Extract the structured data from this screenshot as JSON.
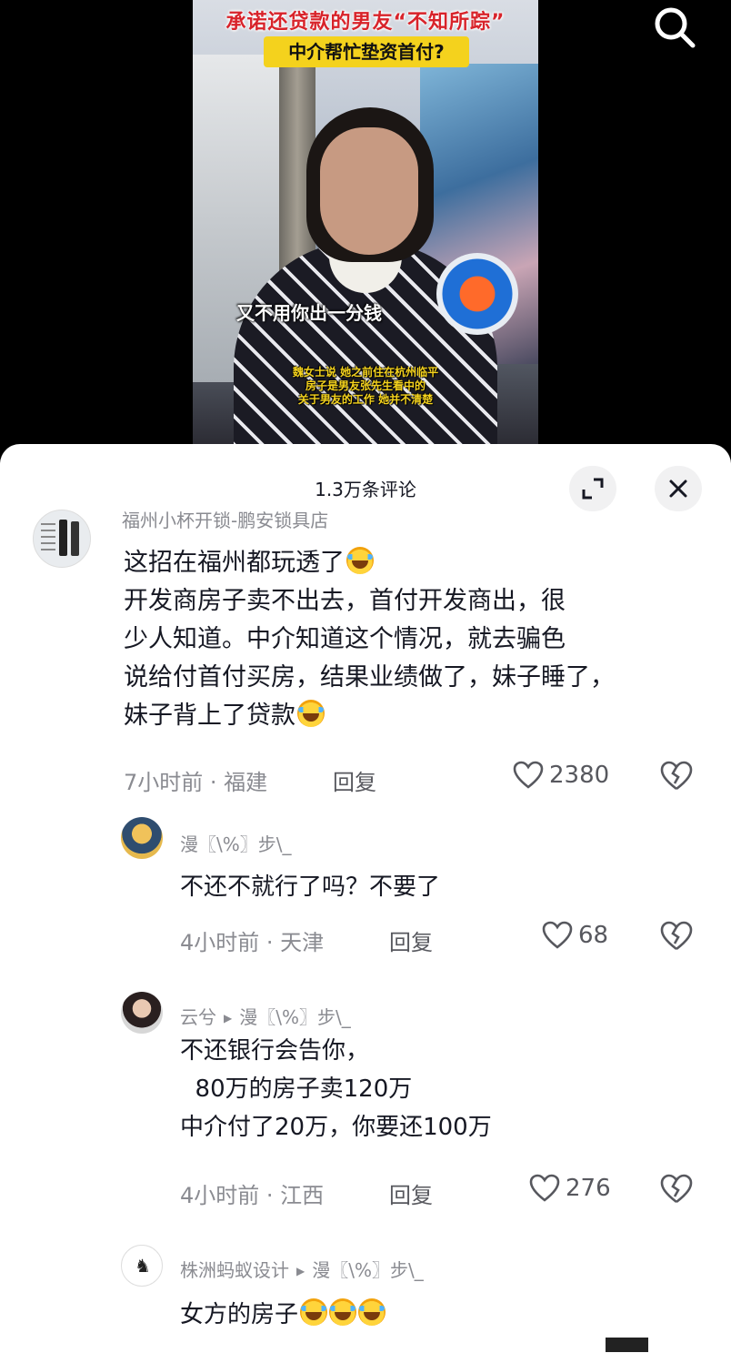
{
  "video": {
    "title": "承诺还贷款的男友“不知所踪”",
    "subtitle": "中介帮忙垫资首付?",
    "quote": "又不用你出一分钱",
    "caption_lines": [
      "魏女士说 她之前住在杭州临平",
      "房子是男友张先生看中的",
      "关于男友的工作 她并不清楚"
    ]
  },
  "sheet": {
    "title": "1.3万条评论"
  },
  "comments": {
    "main": {
      "username": "福州小杯开锁-鹏安锁具店",
      "text": "这招在福州都玩透了",
      "text_lines": [
        "开发商房子卖不出去，首付开发商出，很",
        "少人知道。中介知道这个情况，就去骗色",
        "说给付首付买房，结果业绩做了，妹子睡了，",
        "妹子背上了贷款"
      ],
      "time": "7小时前 · 福建",
      "reply_label": "回复",
      "likes": "2380"
    },
    "reply1": {
      "username": "漫〖\\%〗步\\_",
      "text": "不还不就行了吗？不要了",
      "time": "4小时前 · 天津",
      "reply_label": "回复",
      "likes": "68"
    },
    "reply2": {
      "username": "云兮",
      "reply_to": "漫〖\\%〗步\\_",
      "text_lines": [
        "不还银行会告你，",
        "  80万的房子卖120万",
        "中介付了20万，你要还100万"
      ],
      "time": "4小时前 · 江西",
      "reply_label": "回复",
      "likes": "276"
    },
    "reply3": {
      "username": "株洲蚂蚁设计",
      "reply_to": "漫〖\\%〗步\\_",
      "text": "女方的房子"
    }
  },
  "colors": {
    "title_red": "#d8232a",
    "subtitle_yellow": "#f4d21d",
    "text_primary": "#161823",
    "text_secondary": "#8a8b91"
  },
  "icons": {
    "search": "search-icon",
    "expand": "expand-icon",
    "close": "close-icon",
    "like": "heart-icon",
    "dislike": "broken-heart-icon",
    "emoji": "laugh-cry-emoji"
  }
}
